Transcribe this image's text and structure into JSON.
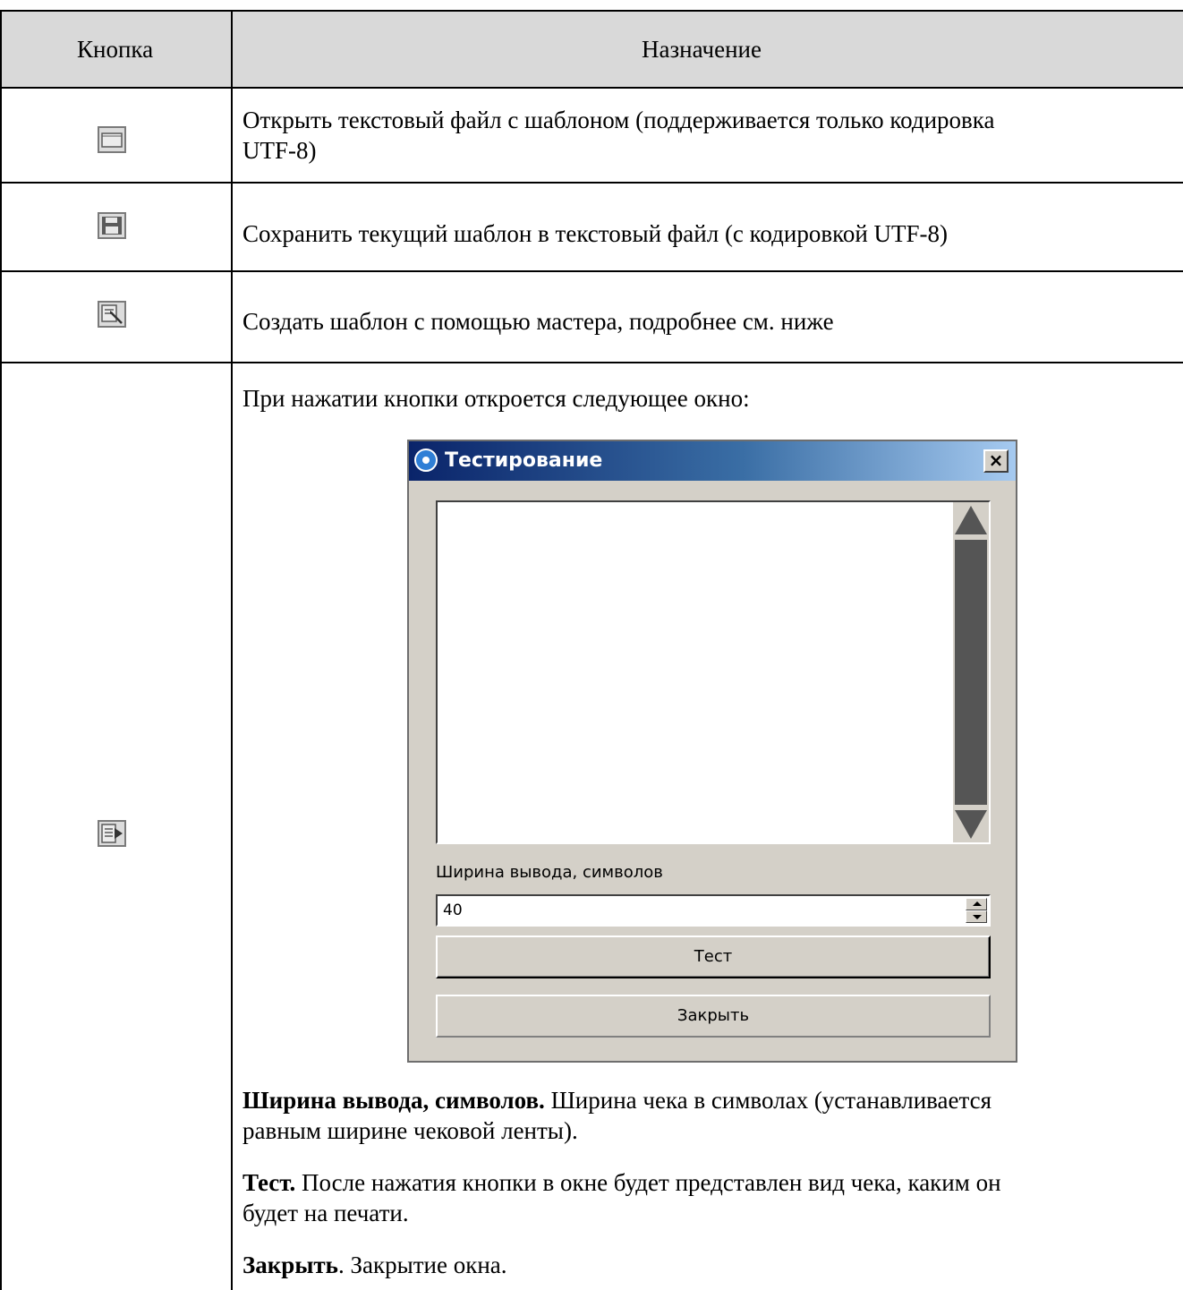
{
  "table": {
    "headers": [
      "Кнопка",
      "Назначение"
    ],
    "rows": [
      {
        "icon": "folder-icon",
        "text_line1": "Открыть текстовый файл с шаблоном (поддерживается только кодировка",
        "text_line2": "UTF-8)"
      },
      {
        "icon": "save-icon",
        "text": "Сохранить текущий шаблон в текстовый файл (с кодировкой UTF-8)"
      },
      {
        "icon": "wizard-icon",
        "text": "Создать шаблон с помощью мастера, подробнее см. ниже"
      },
      {
        "icon": "test-run-icon",
        "intro": "При нажатии кнопки откроется следующее окно:",
        "desc_width_term": "Ширина вывода, символов.",
        "desc_width_line1": " Ширина чека в символах (устанавливается",
        "desc_width_line2": "равным ширине чековой ленты).",
        "desc_test_term": "Тест.",
        "desc_test_line1": " После нажатия кнопки в окне будет представлен вид чека, каким он",
        "desc_test_line2": "будет на печати.",
        "desc_close_term": "Закрыть",
        "desc_close_rest": ". Закрытие окна."
      }
    ]
  },
  "dialog": {
    "title": "Тестирование",
    "close_glyph": "×",
    "width_label": "Ширина вывода, символов",
    "width_value": "40",
    "test_button": "Тест",
    "close_button": "Закрыть"
  }
}
